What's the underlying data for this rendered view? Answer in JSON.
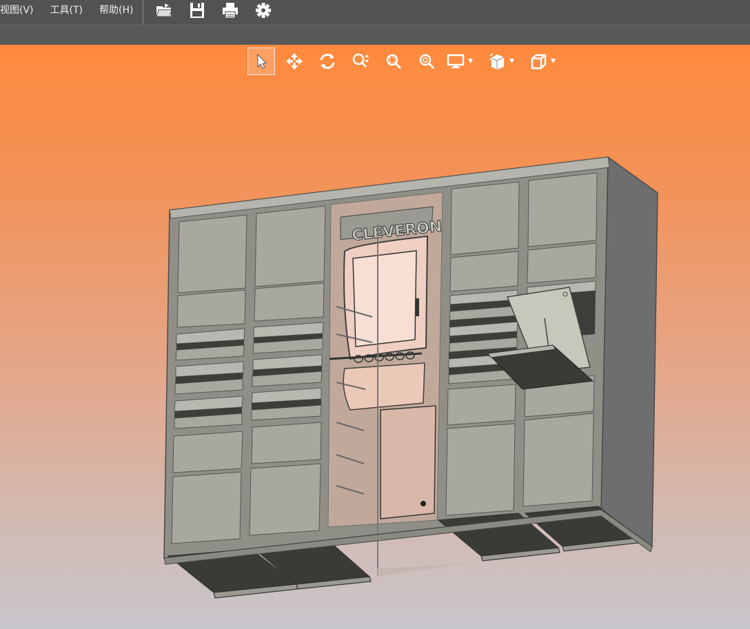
{
  "menu": {
    "items": [
      "视图(V)",
      "工具(T)",
      "帮助(H)"
    ]
  },
  "toolbar": {
    "icons": [
      "open-folder-icon",
      "save-icon",
      "print-icon",
      "gear-icon"
    ]
  },
  "viewport_toolbar": {
    "tools": [
      "select-arrow-icon",
      "pan-icon",
      "rotate-icon",
      "zoom-icon",
      "zoom-window-icon",
      "zoom-fit-icon",
      "display-mode-icon",
      "section-view-icon",
      "view-cube-icon"
    ]
  },
  "model": {
    "brand_label": "CLEVERON"
  },
  "colors": {
    "menubar": "#525252",
    "viewport_top": "#ff8a3d",
    "viewport_bottom": "#c8c6cc",
    "panel": "#a8a89e",
    "frame": "#8d8d85"
  }
}
